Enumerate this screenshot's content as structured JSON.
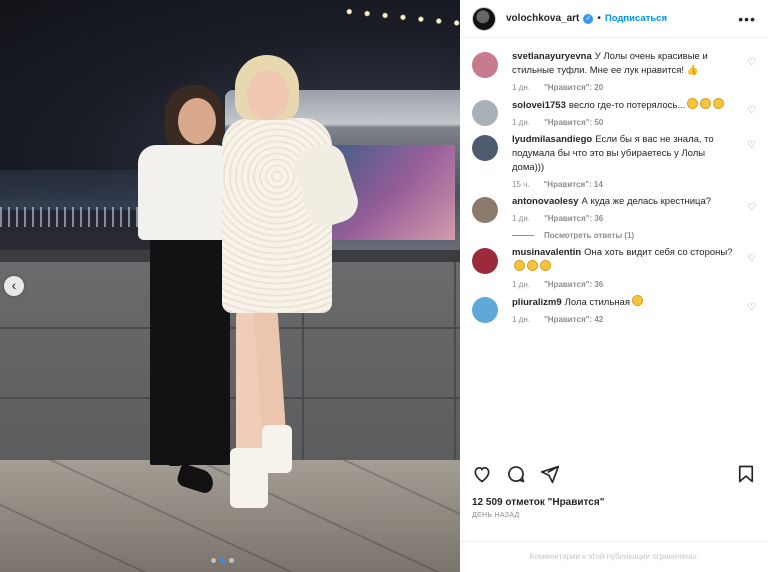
{
  "post": {
    "username": "volochkova_art",
    "follow_label": "Подписаться",
    "separator": "•",
    "more_label": "•••",
    "likes_text": "12 509 отметок \"Нравится\"",
    "time_text": "день назад",
    "comments_disabled_text": "Комментарии к этой публикации ограничены."
  },
  "carousel": {
    "prev_label": "‹",
    "slides": 3,
    "active_slide": 2
  },
  "comments": [
    {
      "user": "svetlanayuryevna",
      "text": "У Лолы очень красивые и стильные туфли. Мне ее лук нравится! 👍",
      "time": "1 дн.",
      "likes": "\"Нравится\": 20",
      "avatar_color": "#c77b8f"
    },
    {
      "user": "solovei1753",
      "text": "весло где-то потерялось...",
      "emoji_count": 3,
      "time": "1 дн.",
      "likes": "\"Нравится\": 50",
      "avatar_color": "#aab0b8"
    },
    {
      "user": "lyudmilasandiego",
      "text": "Если бы я вас не знала, то подумала бы что это вы убираетесь у Лолы дома)))",
      "time": "15 ч.",
      "likes": "\"Нравится\": 14",
      "avatar_color": "#4e5a6e"
    },
    {
      "user": "antonovaolesy",
      "text": "А куда же делась крестница?",
      "time": "1 дн.",
      "likes": "\"Нравится\": 36",
      "avatar_color": "#8c7a6a",
      "replies": "Посмотреть ответы (1)"
    },
    {
      "user": "musinavalentin",
      "text": "Она хоть видит себя со стороны?",
      "emoji_count": 3,
      "time": "1 дн.",
      "likes": "\"Нравится\": 36",
      "avatar_color": "#9b2b3b"
    },
    {
      "user": "pliuralizm9",
      "text": "Лола стильная",
      "emoji_count": 1,
      "time": "1 дн.",
      "likes": "\"Нравится\": 42",
      "avatar_color": "#5fa8d8"
    }
  ],
  "colors": {
    "accent": "#0095f6",
    "verified": "#3897f0",
    "muted": "#8e8e8e"
  },
  "icons": [
    "heart-icon",
    "comment-icon",
    "share-icon",
    "bookmark-icon",
    "verified-icon",
    "more-icon"
  ]
}
